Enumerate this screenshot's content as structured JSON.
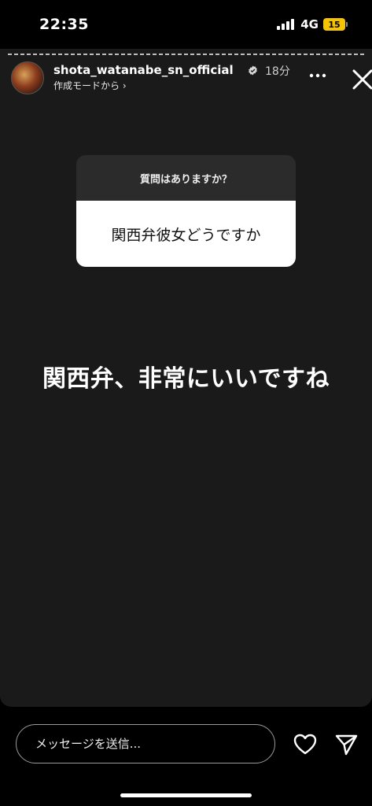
{
  "status_bar": {
    "time": "22:35",
    "network": "4G",
    "battery": "15"
  },
  "story": {
    "username": "shota_watanabe_sn_official",
    "time_ago": "18分",
    "subtitle": "作成モードから ›",
    "question_sticker": {
      "header": "質問はありますか？",
      "question": "関西弁彼女どうですか"
    },
    "answer": "関西弁、非常にいいですね"
  },
  "bottom_bar": {
    "message_placeholder": "メッセージを送信..."
  },
  "icons": {
    "verified": "verified-badge-icon",
    "more": "more-dots-icon",
    "close": "close-icon",
    "heart": "heart-icon",
    "send": "send-icon"
  }
}
